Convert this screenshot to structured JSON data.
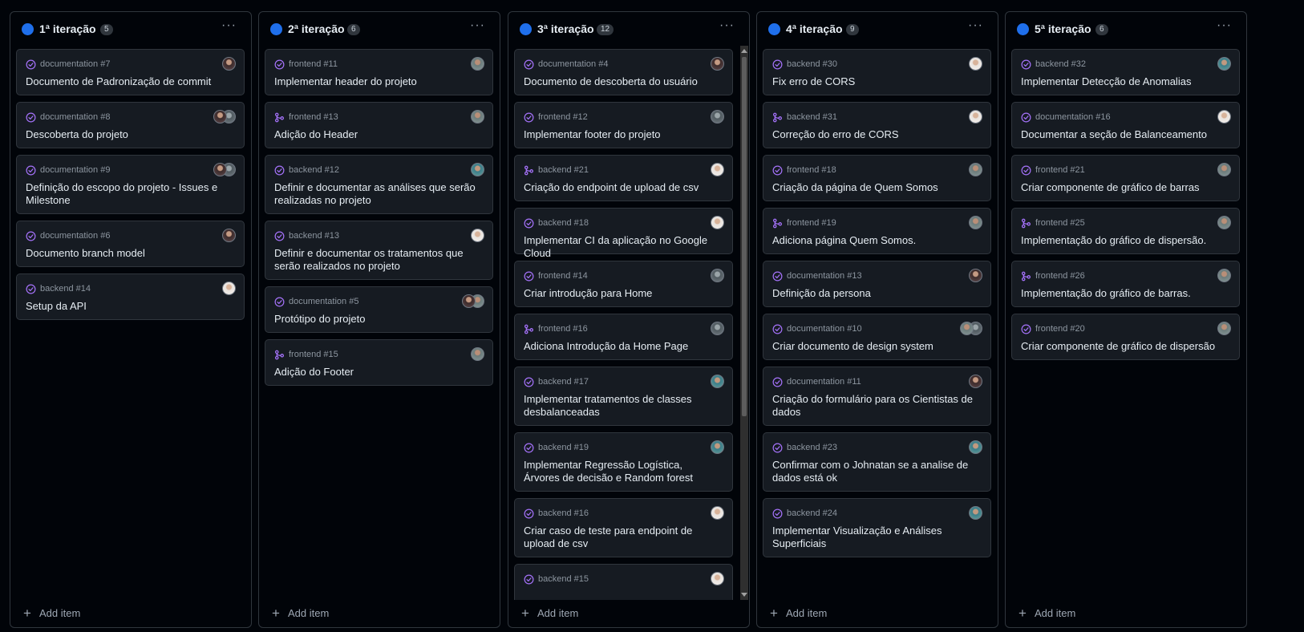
{
  "colors": {
    "status_dot": "#1f6feb",
    "issue_icon": "#a371f7",
    "background": "#010409",
    "card": "#161b22"
  },
  "add_item_label": "Add item",
  "columns": [
    {
      "title": "1ª iteração",
      "count": "5",
      "cards": [
        {
          "meta": "documentation #7",
          "title": "Documento de Padronização de commit",
          "icon": "issue-closed-icon",
          "avatars": [
            "a"
          ]
        },
        {
          "meta": "documentation #8",
          "title": "Descoberta do projeto",
          "icon": "issue-closed-icon",
          "avatars": [
            "e",
            "a"
          ]
        },
        {
          "meta": "documentation #9",
          "title": "Definição do escopo do projeto - Issues e Milestone",
          "icon": "issue-closed-icon",
          "avatars": [
            "e",
            "a"
          ]
        },
        {
          "meta": "documentation #6",
          "title": "Documento branch model",
          "icon": "issue-closed-icon",
          "avatars": [
            "a"
          ]
        },
        {
          "meta": "backend #14",
          "title": "Setup da API",
          "icon": "issue-closed-icon",
          "avatars": [
            "c"
          ]
        }
      ]
    },
    {
      "title": "2ª iteração",
      "count": "6",
      "cards": [
        {
          "meta": "frontend #11",
          "title": "Implementar header do projeto",
          "icon": "issue-closed-icon",
          "avatars": [
            "b"
          ]
        },
        {
          "meta": "frontend #13",
          "title": "Adição do Header",
          "icon": "pull-request-merged-icon",
          "avatars": [
            "b"
          ]
        },
        {
          "meta": "backend #12",
          "title": "Definir e documentar as análises que serão realizadas no projeto",
          "icon": "issue-closed-icon",
          "avatars": [
            "d"
          ]
        },
        {
          "meta": "backend #13",
          "title": "Definir e documentar os tratamentos que serão realizados no projeto",
          "icon": "issue-closed-icon",
          "avatars": [
            "c"
          ]
        },
        {
          "meta": "documentation #5",
          "title": "Protótipo do projeto",
          "icon": "issue-closed-icon",
          "avatars": [
            "b",
            "a"
          ]
        },
        {
          "meta": "frontend #15",
          "title": "Adição do Footer",
          "icon": "pull-request-merged-icon",
          "avatars": [
            "b"
          ]
        }
      ]
    },
    {
      "title": "3ª iteração",
      "count": "12",
      "cards": [
        {
          "meta": "documentation #4",
          "title": "Documento de descoberta do usuário",
          "icon": "issue-closed-icon",
          "avatars": [
            "a"
          ]
        },
        {
          "meta": "frontend #12",
          "title": "Implementar footer do projeto",
          "icon": "issue-closed-icon",
          "avatars": [
            "e"
          ]
        },
        {
          "meta": "backend #21",
          "title": "Criação do endpoint de upload de csv",
          "icon": "pull-request-merged-icon",
          "avatars": [
            "c"
          ]
        },
        {
          "meta": "backend #18",
          "title": "Implementar CI da aplicação no Google Cloud",
          "icon": "issue-closed-icon",
          "avatars": [
            "c"
          ]
        },
        {
          "meta": "frontend #14",
          "title": "Criar introdução para Home",
          "icon": "issue-closed-icon",
          "avatars": [
            "e"
          ]
        },
        {
          "meta": "frontend #16",
          "title": "Adiciona Introdução da Home Page",
          "icon": "pull-request-merged-icon",
          "avatars": [
            "e"
          ]
        },
        {
          "meta": "backend #17",
          "title": "Implementar tratamentos de classes desbalanceadas",
          "icon": "issue-closed-icon",
          "avatars": [
            "d"
          ]
        },
        {
          "meta": "backend #19",
          "title": "Implementar Regressão Logística, Árvores de decisão e Random forest",
          "icon": "issue-closed-icon",
          "avatars": [
            "d"
          ]
        },
        {
          "meta": "backend #16",
          "title": "Criar caso de teste para endpoint de upload de csv",
          "icon": "issue-closed-icon",
          "avatars": [
            "c"
          ]
        },
        {
          "meta": "backend #15",
          "title": "",
          "icon": "issue-closed-icon",
          "avatars": [
            "c"
          ]
        }
      ]
    },
    {
      "title": "4ª iteração",
      "count": "9",
      "cards": [
        {
          "meta": "backend #30",
          "title": "Fix erro de CORS",
          "icon": "issue-closed-icon",
          "avatars": [
            "c"
          ]
        },
        {
          "meta": "backend #31",
          "title": "Correção do erro de CORS",
          "icon": "pull-request-merged-icon",
          "avatars": [
            "c"
          ]
        },
        {
          "meta": "frontend #18",
          "title": "Criação da página de Quem Somos",
          "icon": "issue-closed-icon",
          "avatars": [
            "b"
          ]
        },
        {
          "meta": "frontend #19",
          "title": "Adiciona página Quem Somos.",
          "icon": "pull-request-merged-icon",
          "avatars": [
            "b"
          ]
        },
        {
          "meta": "documentation #13",
          "title": "Definição da persona",
          "icon": "issue-closed-icon",
          "avatars": [
            "a"
          ]
        },
        {
          "meta": "documentation #10",
          "title": "Criar documento de design system",
          "icon": "issue-closed-icon",
          "avatars": [
            "e",
            "b"
          ]
        },
        {
          "meta": "documentation #11",
          "title": "Criação do formulário para os Cientistas de dados",
          "icon": "issue-closed-icon",
          "avatars": [
            "a"
          ]
        },
        {
          "meta": "backend #23",
          "title": "Confirmar com o Johnatan se a analise de dados está ok",
          "icon": "issue-closed-icon",
          "avatars": [
            "d"
          ]
        },
        {
          "meta": "backend #24",
          "title": "Implementar Visualização e Análises Superficiais",
          "icon": "issue-closed-icon",
          "avatars": [
            "d"
          ]
        }
      ]
    },
    {
      "title": "5ª iteração",
      "count": "6",
      "cards": [
        {
          "meta": "backend #32",
          "title": "Implementar Detecção de Anomalias",
          "icon": "issue-closed-icon",
          "avatars": [
            "d"
          ]
        },
        {
          "meta": "documentation #16",
          "title": "Documentar a seção de Balanceamento",
          "icon": "issue-closed-icon",
          "avatars": [
            "c"
          ]
        },
        {
          "meta": "frontend #21",
          "title": "Criar componente de gráfico de barras",
          "icon": "issue-closed-icon",
          "avatars": [
            "b"
          ]
        },
        {
          "meta": "frontend #25",
          "title": "Implementação do gráfico de dispersão.",
          "icon": "pull-request-merged-icon",
          "avatars": [
            "b"
          ]
        },
        {
          "meta": "frontend #26",
          "title": "Implementação do gráfico de barras.",
          "icon": "pull-request-merged-icon",
          "avatars": [
            "b"
          ]
        },
        {
          "meta": "frontend #20",
          "title": "Criar componente de gráfico de dispersão",
          "icon": "issue-closed-icon",
          "avatars": [
            "b"
          ]
        }
      ]
    }
  ]
}
